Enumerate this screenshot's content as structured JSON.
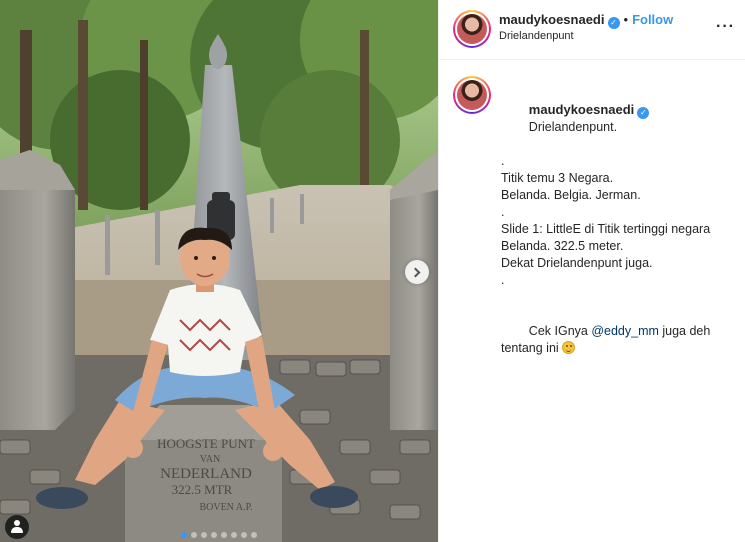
{
  "post": {
    "username": "maudykoesnaedi",
    "header_separator": "•",
    "follow_label": "Follow",
    "location": "Drielandenpunt",
    "more_icon": "more-options-icon",
    "carousel": {
      "slide_count": 8,
      "active_index": 0,
      "next_icon": "chevron-right-icon",
      "tag_icon": "user-tag-icon"
    },
    "photo_text": {
      "plaque_line1": "HOOGSTE PUNT",
      "plaque_line2": "VAN",
      "plaque_line3": "NEDERLAND",
      "plaque_line4": "322.5 MTR",
      "plaque_line5": "BOVEN A.P."
    },
    "caption": {
      "username": "maudykoesnaedi",
      "line1": "Drielandenpunt.",
      "line2": ".",
      "line3": "Titik temu 3 Negara.",
      "line4": "Belanda. Belgia. Jerman.",
      "line5": ".",
      "line6": "Slide 1: LittleE di Titik tertinggi negara Belanda. 322.5 meter.",
      "line7": "Dekat Drielandenpunt juga.",
      "line8": ".",
      "line9_before": "Cek IGnya ",
      "line9_mention": "@eddy_mm",
      "line9_after": " juga deh tentang ini ",
      "emoji_icon": "smiling-face-emoji"
    },
    "colors": {
      "accent": "#3897f0",
      "text": "#262626",
      "mention": "#00376b",
      "divider": "#efefef"
    }
  }
}
